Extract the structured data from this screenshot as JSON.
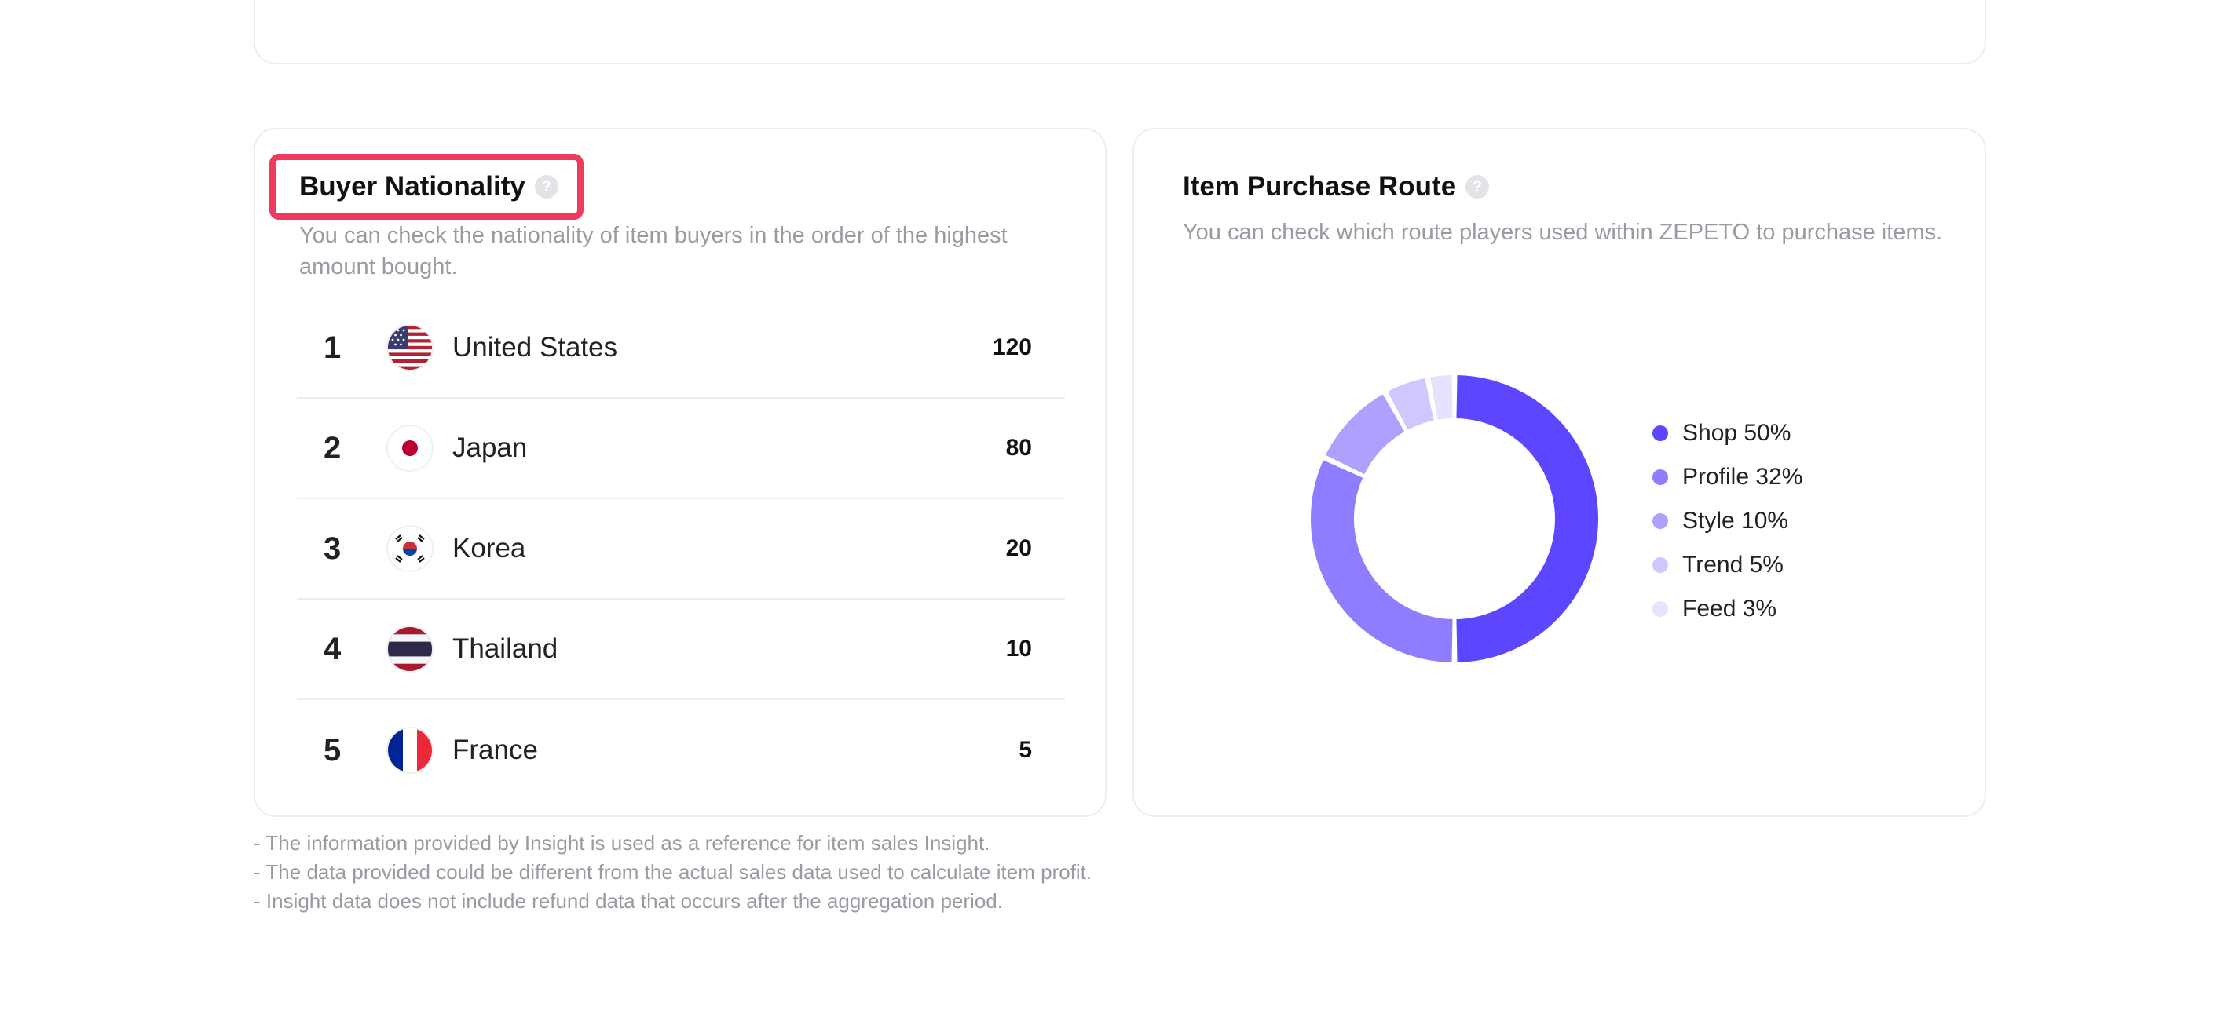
{
  "nationality": {
    "title": "Buyer Nationality",
    "help": "?",
    "description": "You can check the nationality of item buyers in the order of the highest amount bought.",
    "rows": [
      {
        "rank": "1",
        "country": "United States",
        "amount": "120"
      },
      {
        "rank": "2",
        "country": "Japan",
        "amount": "80"
      },
      {
        "rank": "3",
        "country": "Korea",
        "amount": "20"
      },
      {
        "rank": "4",
        "country": "Thailand",
        "amount": "10"
      },
      {
        "rank": "5",
        "country": "France",
        "amount": "5"
      }
    ]
  },
  "route": {
    "title": "Item Purchase Route",
    "help": "?",
    "description": "You can check which route players used within ZEPETO to purchase items.",
    "segments": [
      {
        "label": "Shop 50%",
        "value": 50,
        "color": "#5c46ff"
      },
      {
        "label": "Profile 32%",
        "value": 32,
        "color": "#8f7dff"
      },
      {
        "label": "Style 10%",
        "value": 10,
        "color": "#ada1fd"
      },
      {
        "label": "Trend 5%",
        "value": 5,
        "color": "#cfc7fe"
      },
      {
        "label": "Feed 3%",
        "value": 3,
        "color": "#e7e2fe"
      }
    ]
  },
  "notes": [
    "- The information provided by Insight is used as a reference for item sales Insight.",
    "- The data provided could be different from the actual sales data used to calculate item profit.",
    "- Insight data does not include refund data that occurs after the aggregation period."
  ]
}
